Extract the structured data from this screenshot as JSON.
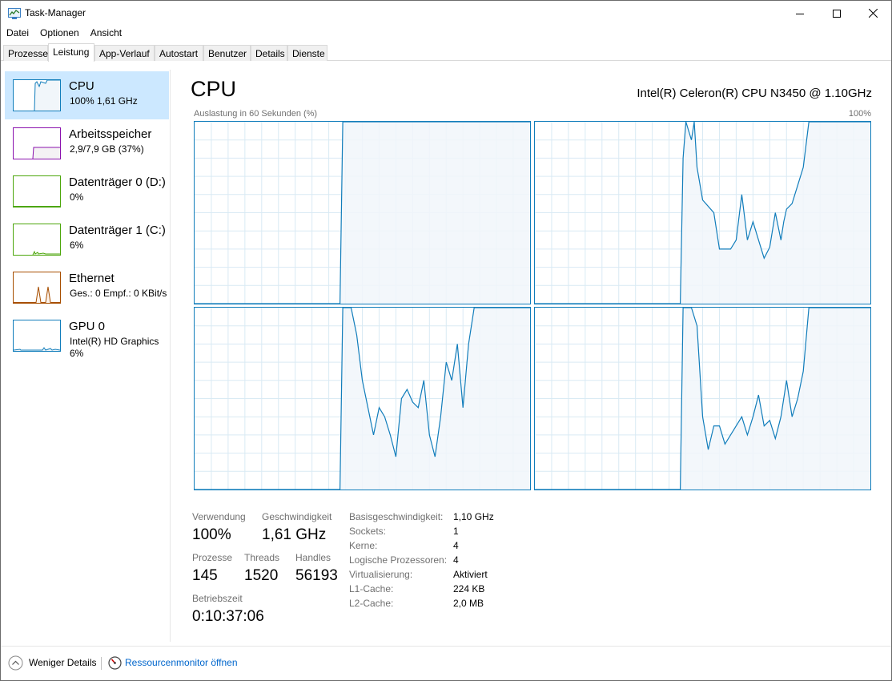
{
  "window": {
    "title": "Task-Manager"
  },
  "menu": {
    "items": [
      "Datei",
      "Optionen",
      "Ansicht"
    ]
  },
  "tabs": [
    "Prozesse",
    "Leistung",
    "App-Verlauf",
    "Autostart",
    "Benutzer",
    "Details",
    "Dienste"
  ],
  "active_tab": "Leistung",
  "sidebar": {
    "items": [
      {
        "title": "CPU",
        "sub": "100%  1,61 GHz",
        "sub2": "",
        "color": "#117dbb",
        "fill": "#f1f6fa",
        "level": 1.0,
        "selected": true
      },
      {
        "title": "Arbeitsspeicher",
        "sub": "2,9/7,9 GB (37%)",
        "sub2": "",
        "color": "#8b12ae",
        "fill": "#f4f2f4",
        "level": 0.37,
        "selected": false
      },
      {
        "title": "Datenträger 0 (D:)",
        "sub": "0%",
        "sub2": "",
        "color": "#4da60c",
        "fill": "#eff7ea",
        "level": 0.0,
        "selected": false
      },
      {
        "title": "Datenträger 1 (C:)",
        "sub": "6%",
        "sub2": "",
        "color": "#4da60c",
        "fill": "#eff7ea",
        "level": 0.06,
        "selected": false
      },
      {
        "title": "Ethernet",
        "sub": "Ges.: 0  Empf.: 0 KBit/s",
        "sub2": "",
        "color": "#a74f01",
        "fill": "#fcf3eb",
        "level": 0.0,
        "selected": false
      },
      {
        "title": "GPU 0",
        "sub": "Intel(R) HD Graphics",
        "sub2": "6%",
        "color": "#117dbb",
        "fill": "#f1f6fa",
        "level": 0.06,
        "selected": false
      }
    ]
  },
  "main": {
    "title": "CPU",
    "model": "Intel(R) Celeron(R) CPU N3450 @ 1.10GHz",
    "graph_caption": "Auslastung in 60 Sekunden (%)",
    "graph_max": "100%"
  },
  "chart_data": {
    "type": "area",
    "y_unit": "%",
    "ylim": [
      0,
      100
    ],
    "x_window_seconds": 60,
    "grid": true,
    "colors": {
      "line": "#117dbb",
      "fill": "#f1f6fa",
      "grid": "#d9eaf4"
    },
    "series": [
      {
        "x": [
          0,
          26,
          26.5,
          31,
          31.5,
          42,
          42.5,
          47,
          47.5,
          53.5,
          54,
          60
        ],
        "y": [
          0,
          0,
          100,
          100,
          100,
          100,
          100,
          100,
          100,
          100,
          100,
          100
        ]
      },
      {
        "x": [
          0,
          26,
          26.5,
          27,
          28,
          28.5,
          29,
          30,
          32,
          33,
          35,
          36,
          37,
          38,
          39,
          40,
          41,
          42,
          43,
          44,
          44.5,
          45,
          46,
          47,
          48,
          49,
          60
        ],
        "y": [
          0,
          0,
          80,
          100,
          90,
          100,
          75,
          57,
          50,
          30,
          30,
          35,
          60,
          35,
          45,
          35,
          25,
          31,
          50,
          35,
          45,
          52,
          55,
          65,
          75,
          100,
          100
        ]
      },
      {
        "x": [
          0,
          26,
          26.5,
          28,
          29,
          30,
          31,
          32,
          33,
          34,
          35,
          36,
          37,
          38,
          39,
          40,
          41,
          42,
          43,
          44,
          45,
          46,
          47,
          48,
          49,
          50,
          51,
          60
        ],
        "y": [
          0,
          0,
          100,
          100,
          85,
          60,
          45,
          30,
          45,
          40,
          30,
          18,
          50,
          55,
          48,
          45,
          60,
          30,
          18,
          40,
          70,
          60,
          80,
          45,
          80,
          100,
          100,
          100
        ]
      },
      {
        "x": [
          0,
          26,
          26.5,
          28,
          29,
          30,
          31,
          32,
          33,
          34,
          35,
          36,
          37,
          38,
          39,
          40,
          41,
          42,
          43,
          44,
          45,
          46,
          47,
          48,
          49,
          50,
          60
        ],
        "y": [
          0,
          0,
          100,
          100,
          90,
          40,
          22,
          35,
          35,
          25,
          30,
          35,
          40,
          30,
          40,
          52,
          35,
          38,
          28,
          40,
          60,
          40,
          50,
          65,
          100,
          100,
          100
        ]
      }
    ]
  },
  "stats": {
    "usage_label": "Verwendung",
    "usage_value": "100%",
    "speed_label": "Geschwindigkeit",
    "speed_value": "1,61 GHz",
    "processes_label": "Prozesse",
    "processes_value": "145",
    "threads_label": "Threads",
    "threads_value": "1520",
    "handles_label": "Handles",
    "handles_value": "56193",
    "uptime_label": "Betriebszeit",
    "uptime_value": "0:10:37:06"
  },
  "specs": [
    {
      "label": "Basisgeschwindigkeit:",
      "value": "1,10 GHz"
    },
    {
      "label": "Sockets:",
      "value": "1"
    },
    {
      "label": "Kerne:",
      "value": "4"
    },
    {
      "label": "Logische Prozessoren:",
      "value": "4"
    },
    {
      "label": "Virtualisierung:",
      "value": "Aktiviert"
    },
    {
      "label": "L1-Cache:",
      "value": "224 KB"
    },
    {
      "label": "L2-Cache:",
      "value": "2,0 MB"
    }
  ],
  "footer": {
    "less_details": "Weniger Details",
    "resource_monitor": "Ressourcenmonitor öffnen"
  }
}
